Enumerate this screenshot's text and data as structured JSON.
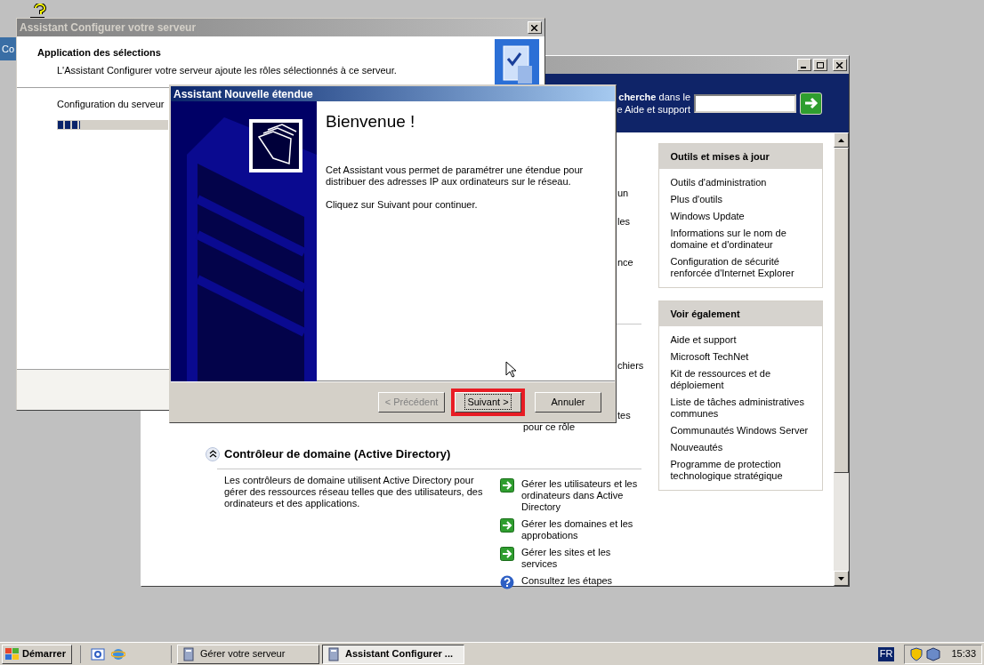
{
  "desktop": {
    "partial_window_text": "Co"
  },
  "manage_window": {
    "active": false,
    "search_prompt": "**cherche** dans le",
    "search_prompt_2": "e Aide et support",
    "fragments": [
      "un",
      "les",
      "nce",
      "chiers",
      "tes",
      "pour ce rôle"
    ],
    "role": {
      "title": "Contrôleur de domaine (Active Directory)",
      "expanded": true,
      "description": "Les contrôleurs de domaine utilisent Active Directory pour gérer des ressources réseau telles que des utilisateurs, des ordinateurs et des applications.",
      "links": [
        {
          "kind": "arrow",
          "label": "Gérer les utilisateurs et les ordinateurs dans Active Directory"
        },
        {
          "kind": "arrow",
          "label": "Gérer les domaines et les approbations"
        },
        {
          "kind": "arrow",
          "label": "Gérer les sites et les services"
        },
        {
          "kind": "help",
          "label": "Consultez les étapes"
        }
      ]
    },
    "panels": [
      {
        "title": "Outils et mises à jour",
        "items": [
          "Outils d'administration",
          "Plus d'outils",
          "Windows Update",
          "Informations sur le nom de domaine et d'ordinateur",
          "Configuration de sécurité renforcée d'Internet Explorer"
        ]
      },
      {
        "title": "Voir également",
        "items": [
          "Aide et support",
          "Microsoft TechNet",
          "Kit de ressources et de déploiement",
          "Liste de tâches administratives communes",
          "Communautés Windows Server",
          "Nouveautés",
          "Programme de protection technologique stratégique"
        ]
      }
    ]
  },
  "configure_wizard": {
    "title": "Assistant Configurer votre serveur",
    "active": false,
    "heading": "Application des sélections",
    "subheading": "L'Assistant Configurer votre serveur ajoute les rôles sélectionnés à ce serveur.",
    "status": "Configuration du serveur",
    "progress": {
      "level": 0.2
    }
  },
  "scope_wizard": {
    "title": "Assistant Nouvelle étendue",
    "active": true,
    "heading": "Bienvenue !",
    "paragraphs": [
      "Cet Assistant vous permet de paramétrer une étendue pour distribuer des adresses IP aux ordinateurs sur le réseau.",
      "Cliquez sur Suivant pour continuer."
    ],
    "buttons": [
      {
        "label": "< Précédent",
        "disabled": true,
        "focused": false,
        "highlighted": false
      },
      {
        "label": "Suivant >",
        "disabled": false,
        "focused": true,
        "highlighted": true
      },
      {
        "label": "Annuler",
        "disabled": false,
        "focused": false,
        "highlighted": false
      }
    ]
  },
  "taskbar": {
    "start": "Démarrer",
    "tasks": [
      {
        "label": "Gérer votre serveur",
        "selected": false
      },
      {
        "label": "Assistant Configurer ...",
        "selected": true
      }
    ],
    "language": "FR",
    "clock": "15:33"
  }
}
